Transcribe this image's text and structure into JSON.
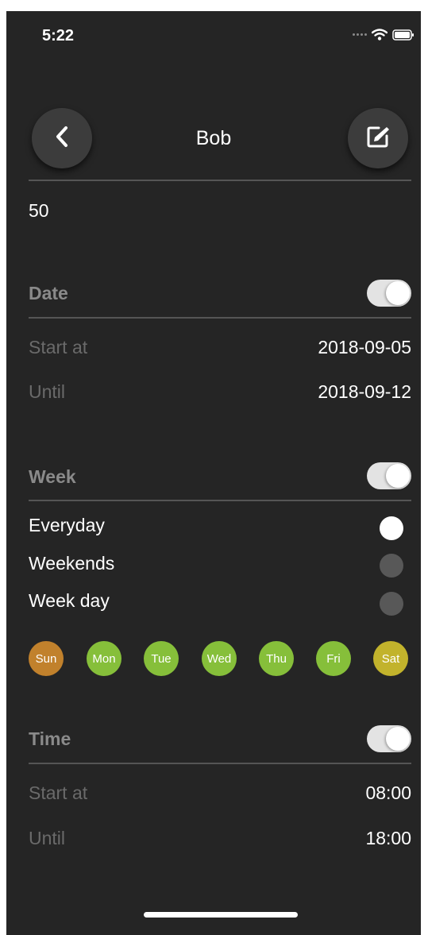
{
  "status_bar": {
    "time": "5:22"
  },
  "header": {
    "title": "Bob"
  },
  "name_value": "50",
  "date_section": {
    "title": "Date",
    "enabled": true,
    "start_label": "Start at",
    "start_value": "2018-09-05",
    "until_label": "Until",
    "until_value": "2018-09-12"
  },
  "week_section": {
    "title": "Week",
    "enabled": true,
    "options": [
      {
        "label": "Everyday",
        "selected": true
      },
      {
        "label": "Weekends",
        "selected": false
      },
      {
        "label": "Week day",
        "selected": false
      }
    ],
    "days": [
      {
        "label": "Sun",
        "color": "#c1812c"
      },
      {
        "label": "Mon",
        "color": "#86bf3a"
      },
      {
        "label": "Tue",
        "color": "#86bf3a"
      },
      {
        "label": "Wed",
        "color": "#86bf3a"
      },
      {
        "label": "Thu",
        "color": "#86bf3a"
      },
      {
        "label": "Fri",
        "color": "#86bf3a"
      },
      {
        "label": "Sat",
        "color": "#c2b32c"
      }
    ]
  },
  "time_section": {
    "title": "Time",
    "enabled": true,
    "start_label": "Start at",
    "start_value": "08:00",
    "until_label": "Until",
    "until_value": "18:00"
  },
  "icons": {
    "back": "chevron-left-icon",
    "edit": "edit-icon",
    "wifi": "wifi-icon",
    "battery": "battery-icon"
  },
  "colors": {
    "background": "#252525",
    "button": "#3c3c3c",
    "divider": "#555555",
    "muted_text": "#6a6a6a",
    "section_title": "#8a8a8a"
  }
}
